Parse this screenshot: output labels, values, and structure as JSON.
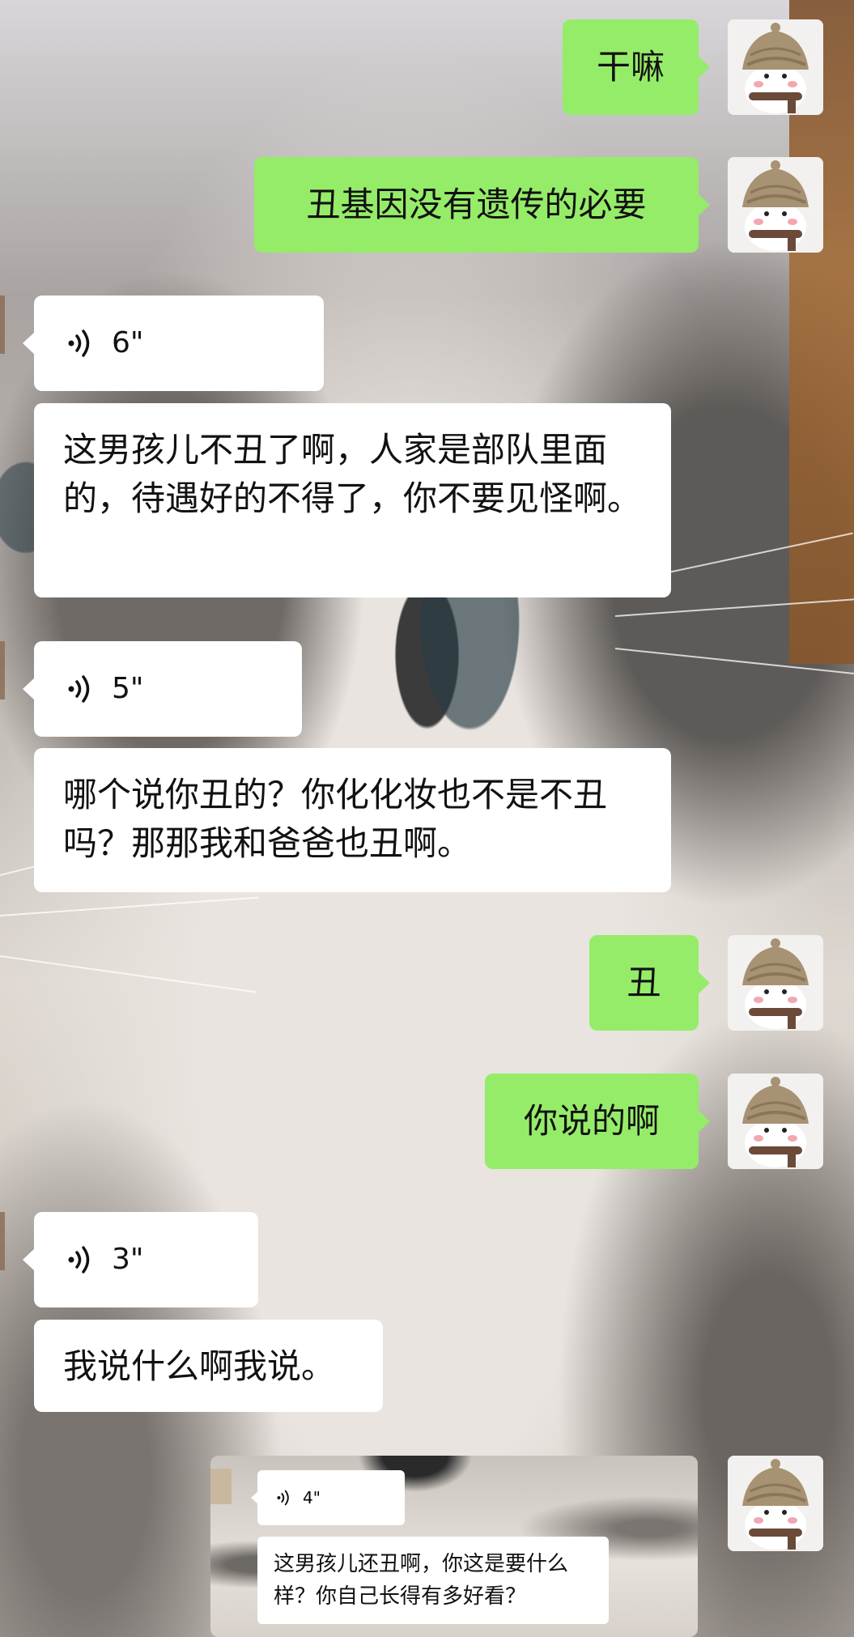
{
  "messages": [
    {
      "side": "me",
      "type": "text",
      "text": "干嘛"
    },
    {
      "side": "me",
      "type": "text",
      "text": "丑基因没有遗传的必要"
    },
    {
      "side": "other",
      "type": "voice",
      "duration": "6\""
    },
    {
      "side": "other",
      "type": "text",
      "text": "这男孩儿不丑了啊，人家是部队里面的，待遇好的不得了，你不要见怪啊。"
    },
    {
      "side": "other",
      "type": "voice",
      "duration": "5\""
    },
    {
      "side": "other",
      "type": "text",
      "text": "哪个说你丑的？你化化妆也不是不丑吗？那那我和爸爸也丑啊。"
    },
    {
      "side": "me",
      "type": "text",
      "text": "丑"
    },
    {
      "side": "me",
      "type": "text",
      "text": "你说的啊"
    },
    {
      "side": "other",
      "type": "voice",
      "duration": "3\""
    },
    {
      "side": "other",
      "type": "text",
      "text": "我说什么啊我说。"
    },
    {
      "side": "me",
      "type": "image",
      "embedded": {
        "voice_duration": "4\"",
        "text": "这男孩儿还丑啊，你这是要什么样？你自己长得有多好看？"
      }
    }
  ],
  "colors": {
    "me_bubble": "#95ec69",
    "other_bubble": "#ffffff"
  },
  "icons": {
    "voice": "voice-wave-icon",
    "avatar": "snowman-avatar-icon"
  }
}
